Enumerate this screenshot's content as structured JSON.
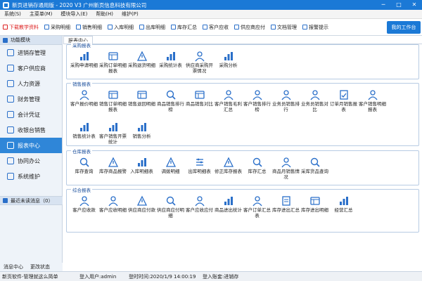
{
  "titlebar": {
    "title": "新页进销存通用版 - 2020 V3 广州新页信息科技有限公司",
    "min": "─",
    "max": "□",
    "close": "✕"
  },
  "menu": [
    "系统(S)",
    "主菜单(M)",
    "模块导入(E)",
    "帮助(H)",
    "维护(P)"
  ],
  "toolbar": {
    "items": [
      "下载教学资料",
      "采购明细",
      "销售明细",
      "入库明细",
      "出库明细",
      "库存汇总",
      "客户应收",
      "供应商应付",
      "文档管理",
      "报警提示"
    ],
    "my_workbench": "我的工作台"
  },
  "sidebar": {
    "header": "功能模块",
    "items": [
      "进销存管理",
      "客户供应商",
      "人力资源",
      "财务管理",
      "会计凭证",
      "收银台销售",
      "报表中心",
      "协同办公",
      "系统维护"
    ],
    "active_index": 6,
    "messages": "最近未读消息（0）",
    "footer": [
      "消息中心",
      "更改状态"
    ]
  },
  "main": {
    "tab": "报表中心",
    "sections": [
      {
        "title": "采购报表",
        "items": [
          "采购申请明细",
          "采购订单明细报表",
          "采购退货明细",
          "采购统计表",
          "供应商采购开票情况",
          "采购分析"
        ]
      },
      {
        "title": "销售报表",
        "items": [
          "客户报价明细",
          "销售订单明细报表",
          "销售退回明细",
          "商品销售排行榜",
          "商品销售对比",
          "客户销售毛利汇总",
          "客户销售排行榜",
          "业务员销售排行",
          "业务员销售对比",
          "订单月销售报表",
          "客户销售明细报表",
          "销售统计表",
          "客户销售开票统计",
          "销售分析"
        ]
      },
      {
        "title": "仓库报表",
        "items": [
          "库存查询",
          "库存商品报警",
          "入库明细表",
          "调拨明细",
          "出库明细表",
          "修正库存报表",
          "库存汇总",
          "商品月销售情况",
          "采库货品查询"
        ]
      },
      {
        "title": "综合报表",
        "items": [
          "客户应收款",
          "客户应收明细",
          "供应商应付款",
          "供应商应付明细",
          "客户应收应付",
          "商品进出统计",
          "客户订单汇总表",
          "库存进出汇总",
          "库存进出明细",
          "经营汇总"
        ]
      }
    ]
  },
  "status": {
    "company": "新页软件-管理就这么简单",
    "user": "登入用户:admin",
    "time": "登时时间:2020/1/9 14:00:19",
    "account": "登入账套:进销存"
  },
  "colors": {
    "accent": "#1b79d6",
    "icon": "#2a6fc9",
    "highlight": "#d22222"
  }
}
